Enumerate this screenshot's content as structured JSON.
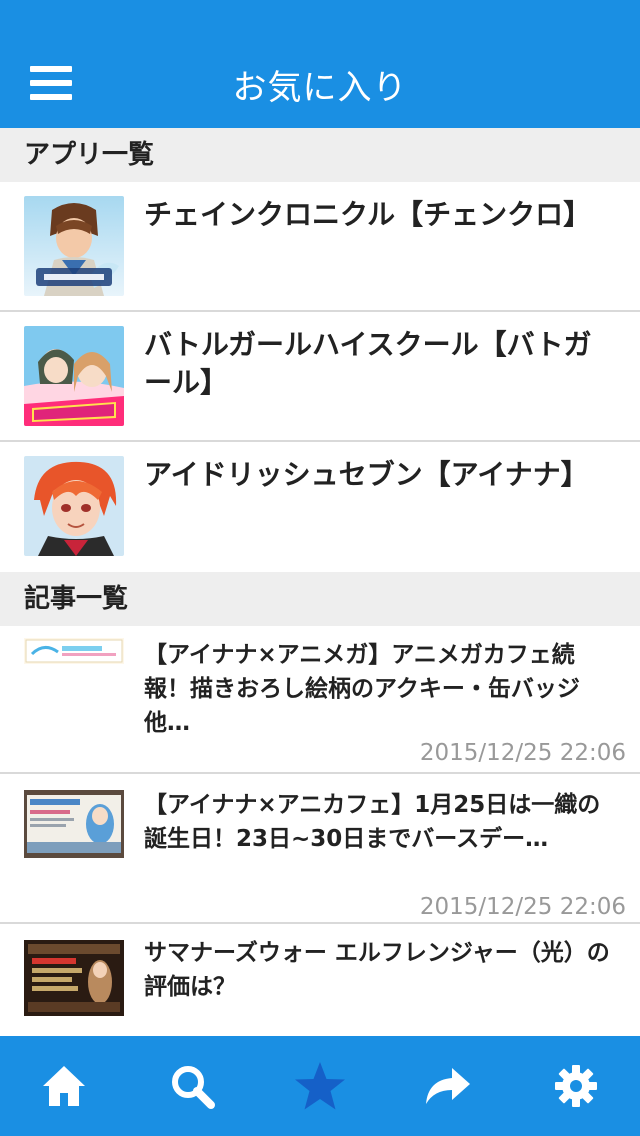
{
  "header": {
    "title": "お気に入り",
    "menu_icon": "menu-icon"
  },
  "apps_section": {
    "label": "アプリ一覧"
  },
  "apps": [
    {
      "name": "チェインクロニクル【チェンクロ】",
      "icon": "chain-chronicle-thumbnail"
    },
    {
      "name": "バトルガールハイスクール【バトガール】",
      "icon": "battle-girl-thumbnail"
    },
    {
      "name": "アイドリッシュセブン【アイナナ】",
      "icon": "idolish7-thumbnail"
    }
  ],
  "articles_section": {
    "label": "記事一覧"
  },
  "articles": [
    {
      "title": "【アイナナ×アニメガ】アニメガカフェ続報！描きおろし絵柄のアクキー・缶バッジ他…",
      "date": "2015/12/25 22:06"
    },
    {
      "title": "【アイナナ×アニカフェ】1月25日は一織の誕生日！23日~30日までバースデー…",
      "date": "2015/12/25 22:06"
    },
    {
      "title": "サマナーズウォー エルフレンジャー（光）の評価は？",
      "date": ""
    }
  ],
  "tabbar": {
    "tabs": [
      {
        "icon": "home-icon"
      },
      {
        "icon": "search-icon"
      },
      {
        "icon": "star-icon",
        "active": true
      },
      {
        "icon": "share-icon"
      },
      {
        "icon": "gear-icon"
      }
    ],
    "active_color": "#1560c8",
    "color": "#ffffff"
  },
  "colors": {
    "brand": "#1a8fe3",
    "section_bg": "#eeeeee",
    "date": "#999999"
  }
}
